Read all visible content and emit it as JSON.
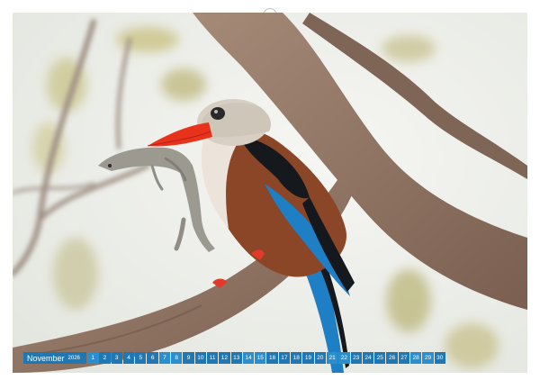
{
  "calendar": {
    "month": "November",
    "year": "2026",
    "days": [
      "1",
      "2",
      "3",
      "4",
      "5",
      "6",
      "7",
      "8",
      "9",
      "10",
      "11",
      "12",
      "13",
      "14",
      "15",
      "16",
      "17",
      "18",
      "19",
      "20",
      "21",
      "22",
      "23",
      "24",
      "25",
      "26",
      "27",
      "28",
      "29",
      "30"
    ]
  },
  "photo": {
    "subject": "grey-headed-kingfisher-with-lizard",
    "colors": {
      "beak": "#e8321c",
      "wing_black": "#15181d",
      "wing_blue": "#1f7fc4",
      "chest": "#8a4626",
      "head": "#d8cfc4",
      "branch": "#8f7462",
      "sky": "#f1f2ee"
    }
  }
}
